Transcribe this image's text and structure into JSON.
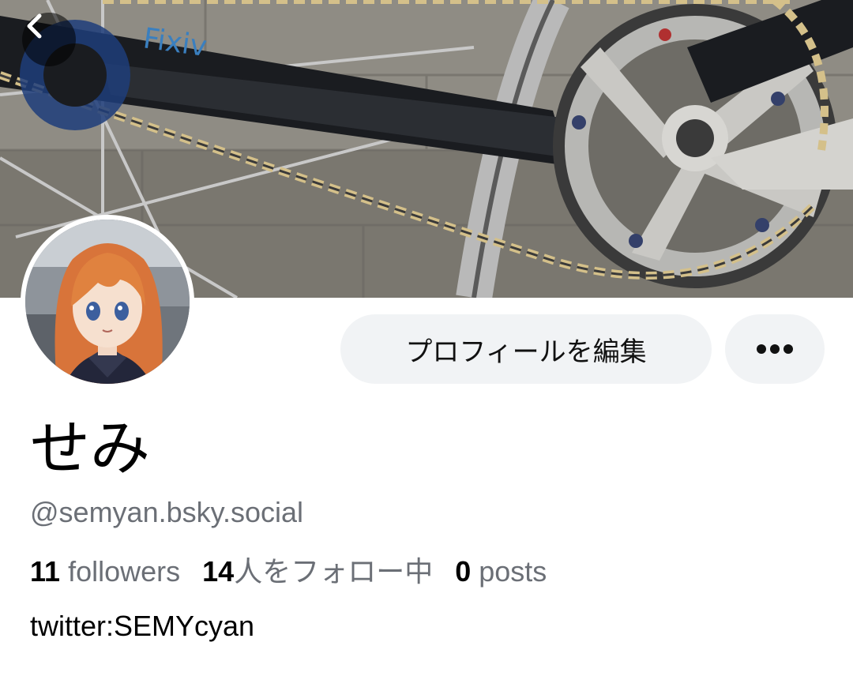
{
  "profile": {
    "display_name": "せみ",
    "handle": "@semyan.bsky.social",
    "bio": "twitter:SEMYcyan"
  },
  "actions": {
    "edit_label": "プロフィールを編集",
    "more_icon": "more-horizontal-icon",
    "back_icon": "chevron-left-icon"
  },
  "stats": {
    "followers_count": "11",
    "followers_label": "followers",
    "following_count": "14",
    "following_label": "人をフォロー中",
    "posts_count": "0",
    "posts_label": "posts"
  },
  "colors": {
    "button_bg": "#f1f3f5",
    "muted_text": "#6b6f76"
  }
}
